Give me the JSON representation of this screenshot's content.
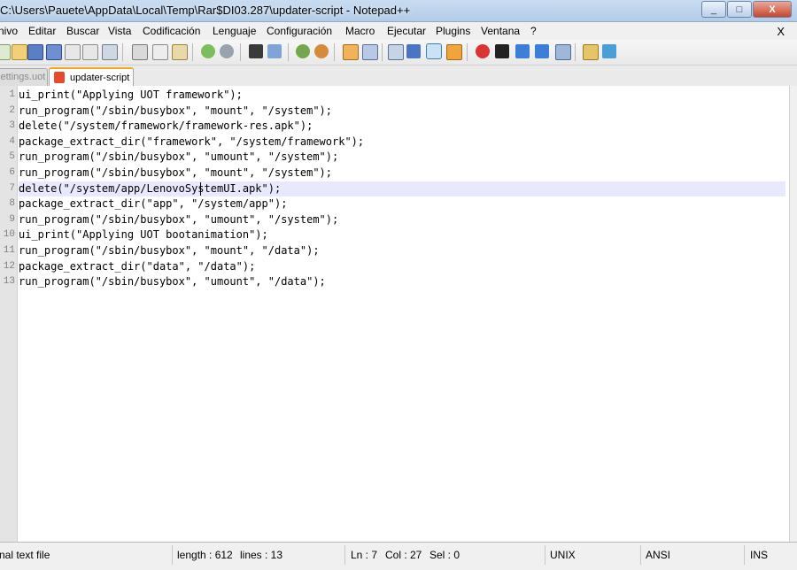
{
  "window": {
    "title": "C:\\Users\\Pauete\\AppData\\Local\\Temp\\Rar$DI03.287\\updater-script - Notepad++",
    "minimize_glyph": "_",
    "maximize_glyph": "□",
    "close_glyph": "X"
  },
  "menu": {
    "items": [
      "nivo",
      "Editar",
      "Buscar",
      "Vista",
      "Codificación",
      "Lenguaje",
      "Configuración",
      "Macro",
      "Ejecutar",
      "Plugins",
      "Ventana",
      "?"
    ],
    "close_label": "X"
  },
  "toolbar": {
    "icons": [
      "new-file-icon",
      "open-file-icon",
      "save-icon",
      "save-all-icon",
      "close-icon",
      "close-all-icon",
      "print-icon",
      "cut-icon",
      "copy-icon",
      "paste-icon",
      "undo-icon",
      "redo-icon",
      "find-icon",
      "replace-icon",
      "zoom-in-icon",
      "zoom-out-icon",
      "sync-vertical-icon",
      "sync-horizontal-icon",
      "word-wrap-icon",
      "show-all-chars-icon",
      "indent-guide-icon",
      "user-lang-icon",
      "record-macro-icon",
      "stop-record-icon",
      "play-macro-icon",
      "run-macro-multiple-icon",
      "save-macro-icon",
      "launch-browser-icon",
      "spell-check-icon"
    ],
    "selected_icon": "indent-guide-icon"
  },
  "tabs": {
    "inactive_label": "settings.uot",
    "active_label": "updater-script"
  },
  "editor": {
    "current_line": 7,
    "lines": [
      "ui_print(\"Applying UOT framework\");",
      "run_program(\"/sbin/busybox\", \"mount\", \"/system\");",
      "delete(\"/system/framework/framework-res.apk\");",
      "package_extract_dir(\"framework\", \"/system/framework\");",
      "run_program(\"/sbin/busybox\", \"umount\", \"/system\");",
      "run_program(\"/sbin/busybox\", \"mount\", \"/system\");",
      "delete(\"/system/app/LenovoSystemUI.apk\");",
      "package_extract_dir(\"app\", \"/system/app\");",
      "run_program(\"/sbin/busybox\", \"umount\", \"/system\");",
      "ui_print(\"Applying UOT bootanimation\");",
      "run_program(\"/sbin/busybox\", \"mount\", \"/data\");",
      "package_extract_dir(\"data\", \"/data\");",
      "run_program(\"/sbin/busybox\", \"umount\", \"/data\");"
    ]
  },
  "status": {
    "file_type": "nal text file",
    "length": "length : 612",
    "lines": "lines : 13",
    "ln": "Ln : 7",
    "col": "Col : 27",
    "sel": "Sel : 0",
    "eol": "UNIX",
    "encoding": "ANSI",
    "mode": "INS"
  },
  "colors": {
    "current_line_bg": "#e8e8ff",
    "active_tab_accent": "#f5a623",
    "line_number": "#808080"
  }
}
